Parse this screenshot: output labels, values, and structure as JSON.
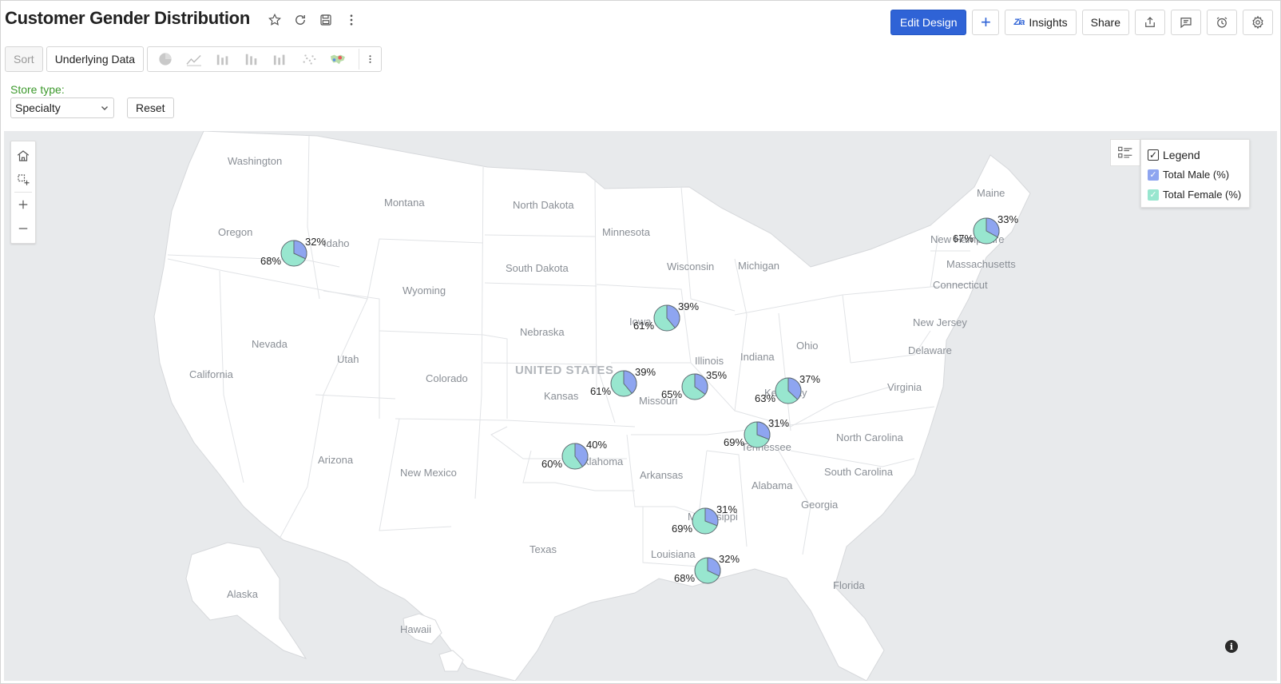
{
  "header": {
    "title": "Customer Gender Distribution",
    "edit_design": "Edit Design",
    "insights": "Insights",
    "insights_logo": "Zia",
    "share": "Share",
    "plus": "+"
  },
  "toolbar": {
    "sort": "Sort",
    "underlying_data": "Underlying Data",
    "chart_types": [
      "pie-chart-icon",
      "line-chart-icon",
      "bar-chart-icon",
      "stacked-bar-icon",
      "grouped-bar-icon",
      "scatter-icon",
      "geo-map-icon"
    ]
  },
  "filter": {
    "label": "Store type:",
    "value": "Specialty",
    "reset": "Reset"
  },
  "legend": {
    "title": "Legend",
    "items": [
      {
        "label": "Total Male (%)",
        "color": "#8ea5f0"
      },
      {
        "label": "Total Female (%)",
        "color": "#98e6cf"
      }
    ]
  },
  "map": {
    "country_label": "UNITED STATES",
    "states": [
      {
        "name": "Washington"
      },
      {
        "name": "Oregon"
      },
      {
        "name": "Idaho"
      },
      {
        "name": "Montana"
      },
      {
        "name": "North Dakota"
      },
      {
        "name": "South Dakota"
      },
      {
        "name": "Minnesota"
      },
      {
        "name": "Wisconsin"
      },
      {
        "name": "Michigan"
      },
      {
        "name": "Wyoming"
      },
      {
        "name": "Nebraska"
      },
      {
        "name": "Iowa"
      },
      {
        "name": "Illinois"
      },
      {
        "name": "Indiana"
      },
      {
        "name": "Ohio"
      },
      {
        "name": "Nevada"
      },
      {
        "name": "Utah"
      },
      {
        "name": "Colorado"
      },
      {
        "name": "Kansas"
      },
      {
        "name": "Missouri"
      },
      {
        "name": "California"
      },
      {
        "name": "Kentucky"
      },
      {
        "name": "Virginia"
      },
      {
        "name": "Tennessee"
      },
      {
        "name": "North Carolina"
      },
      {
        "name": "South Carolina"
      },
      {
        "name": "Arizona"
      },
      {
        "name": "New Mexico"
      },
      {
        "name": "Oklahoma"
      },
      {
        "name": "Arkansas"
      },
      {
        "name": "Mississippi"
      },
      {
        "name": "Alabama"
      },
      {
        "name": "Georgia"
      },
      {
        "name": "Texas"
      },
      {
        "name": "Louisiana"
      },
      {
        "name": "Florida"
      },
      {
        "name": "Alaska"
      },
      {
        "name": "Hawaii"
      },
      {
        "name": "Maine"
      },
      {
        "name": "New Hampshire"
      },
      {
        "name": "Massachusetts"
      },
      {
        "name": "Connecticut"
      },
      {
        "name": "New Jersey"
      },
      {
        "name": "Delaware"
      }
    ],
    "pies": [
      {
        "state": "Idaho",
        "male": 32,
        "female": 68
      },
      {
        "state": "Iowa",
        "male": 39,
        "female": 61
      },
      {
        "state": "Kansas",
        "male": 39,
        "female": 61
      },
      {
        "state": "Missouri",
        "male": 35,
        "female": 65
      },
      {
        "state": "Kentucky",
        "male": 37,
        "female": 63
      },
      {
        "state": "Tennessee",
        "male": 31,
        "female": 69
      },
      {
        "state": "Oklahoma",
        "male": 40,
        "female": 60
      },
      {
        "state": "Mississippi",
        "male": 31,
        "female": 69
      },
      {
        "state": "Louisiana",
        "male": 32,
        "female": 68
      },
      {
        "state": "New Hampshire",
        "male": 33,
        "female": 67
      }
    ]
  }
}
